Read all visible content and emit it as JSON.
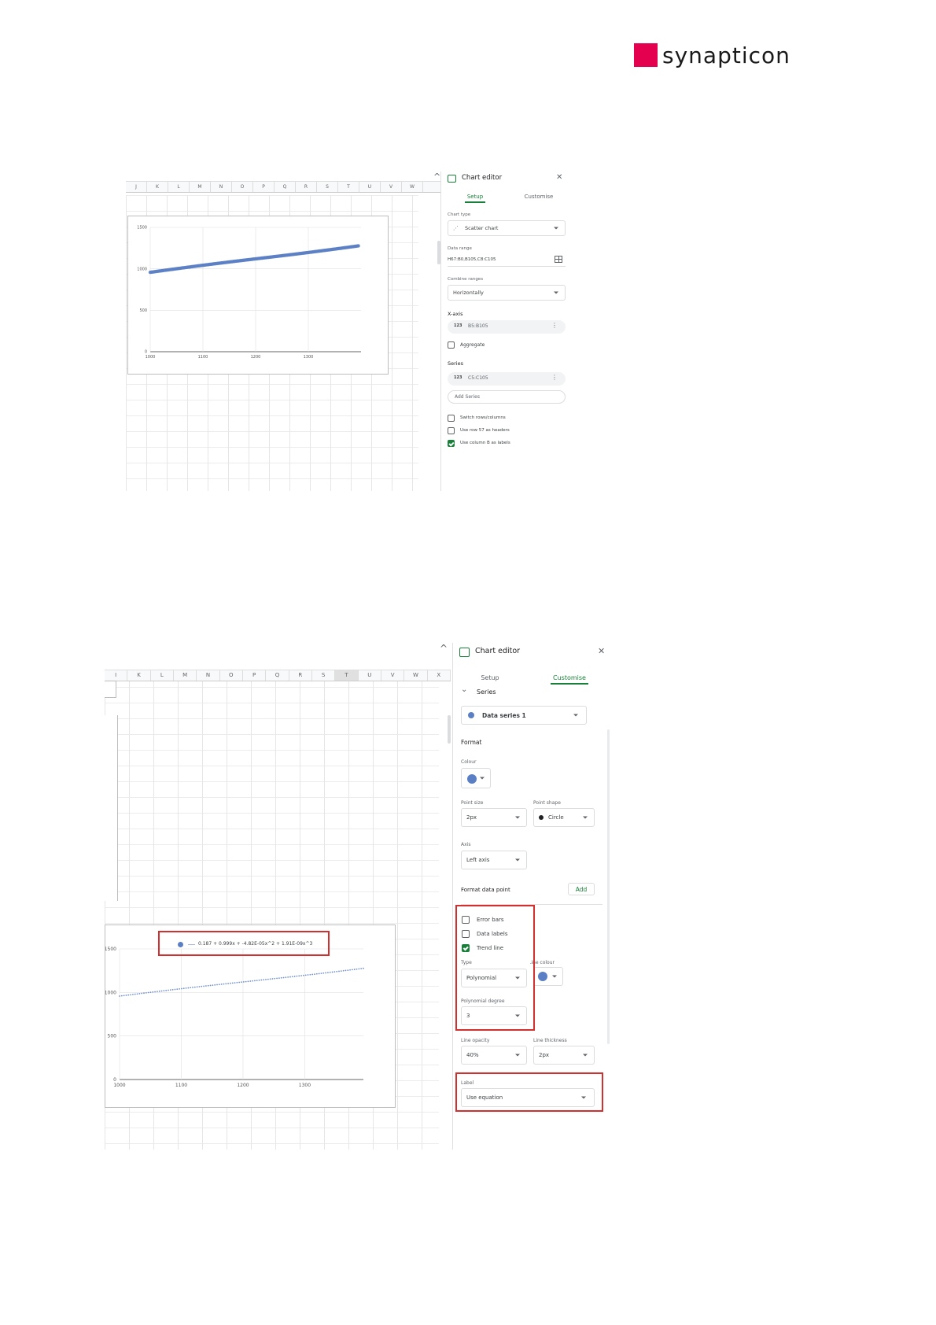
{
  "brand": {
    "logo_text": "synapticon",
    "logo_color": "#e5004f"
  },
  "shot1": {
    "columns": [
      "J",
      "K",
      "L",
      "M",
      "N",
      "O",
      "P",
      "Q",
      "R",
      "S",
      "T",
      "U",
      "V",
      "W"
    ],
    "editor": {
      "title": "Chart editor",
      "tab_setup": "Setup",
      "tab_customise": "Customise",
      "chart_type_label": "Chart type",
      "chart_type_value": "Scatter chart",
      "data_range_label": "Data range",
      "data_range_value": "H67:B0,B105,C8:C105",
      "combine_label": "Combine ranges",
      "combine_value": "Horizontally",
      "xaxis_label": "X-axis",
      "xaxis_value": "B5:B105",
      "aggregate_label": "Aggregate",
      "series_label": "Series",
      "series_value": "C5:C105",
      "add_series": "Add Series",
      "switch_label": "Switch rows/columns",
      "use_row_label": "Use row 57 as headers",
      "use_col_label": "Use column B as labels",
      "icon_123": "123"
    }
  },
  "shot2": {
    "columns": [
      "I",
      "K",
      "L",
      "M",
      "N",
      "O",
      "P",
      "Q",
      "R",
      "S",
      "T",
      "U",
      "V",
      "W",
      "X"
    ],
    "legend_equation": "0.187 + 0.999x + -4.82E-05x^2 + 1.91E-09x^3",
    "editor": {
      "title": "Chart editor",
      "tab_setup": "Setup",
      "tab_customise": "Customise",
      "series_section": "Series",
      "series_select": "Data series 1",
      "format_label": "Format",
      "colour_label": "Colour",
      "point_size_label": "Point size",
      "point_size_value": "2px",
      "point_shape_label": "Point shape",
      "point_shape_value": "Circle",
      "axis_label": "Axis",
      "axis_value": "Left axis",
      "format_data_point": "Format data point",
      "add_label": "Add",
      "error_bars": "Error bars",
      "data_labels": "Data labels",
      "trend_line": "Trend line",
      "type_label": "Type",
      "type_value": "Polynomial",
      "line_colour_label": "Line colour",
      "poly_degree_label": "Polynomial degree",
      "poly_degree_value": "3",
      "line_opacity_label": "Line opacity",
      "line_opacity_value": "40%",
      "line_thickness_label": "Line thickness",
      "line_thickness_value": "2px",
      "label_label": "Label",
      "label_value": "Use equation"
    }
  },
  "chart_data": [
    {
      "type": "scatter",
      "title": "",
      "xlabel": "",
      "ylabel": "",
      "x_ticks": [
        "1000",
        "1100",
        "1200",
        "1300"
      ],
      "y_ticks": [
        "1500",
        "1000",
        "500",
        "0"
      ],
      "xlim": [
        1000,
        1400
      ],
      "ylim": [
        0,
        1500
      ],
      "x_start": 1000,
      "x_end": 1395,
      "y_start": 958,
      "y_end": 1278,
      "color": "#5b7fc4",
      "legend": "none"
    },
    {
      "type": "scatter",
      "title": "",
      "xlabel": "",
      "ylabel": "",
      "x_ticks": [
        "1000",
        "1100",
        "1200",
        "1300"
      ],
      "y_ticks": [
        "1500",
        "1000",
        "500",
        "0"
      ],
      "xlim": [
        1000,
        1395
      ],
      "ylim": [
        0,
        1500
      ],
      "x_start": 1000,
      "x_end": 1395,
      "y_start": 958,
      "y_end": 1278,
      "color": "#5b7fc4",
      "trendline": "polynomial degree 3, equation label",
      "legend": "top"
    }
  ]
}
